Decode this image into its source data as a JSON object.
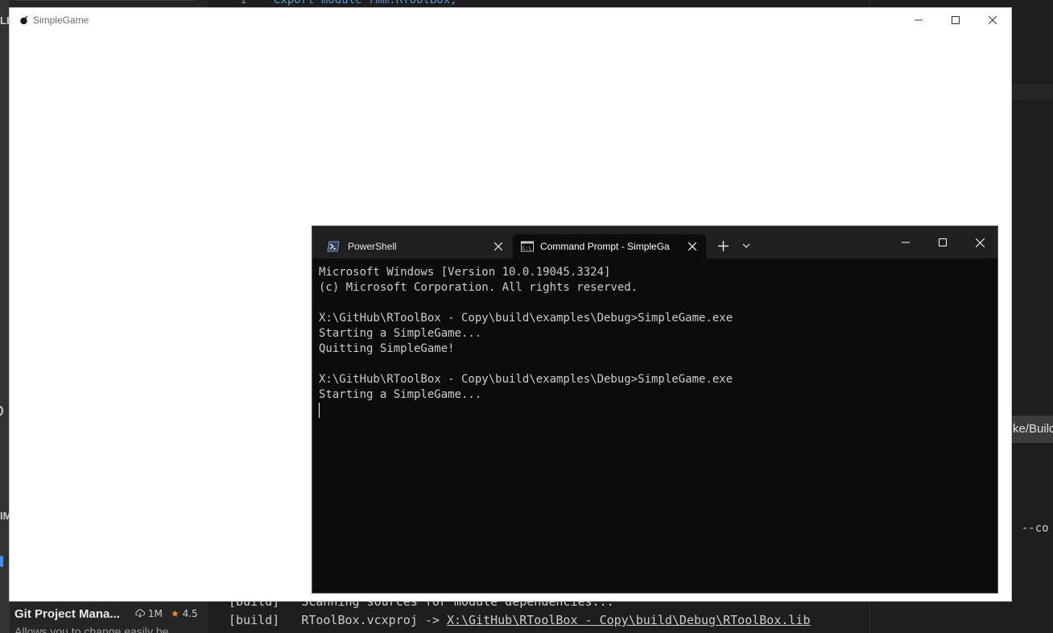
{
  "vscode": {
    "editor": {
      "line_number": "1",
      "code_line": "export module rmm.RToolBox;"
    },
    "sidebar_fragments": {
      "left_top": "LE",
      "left_mid": "IM"
    },
    "right_panel": {
      "tab_fragment": "ke/Build",
      "terminal_fragment": "' --co"
    },
    "terminal_lines": [
      {
        "prefix": "[build]",
        "text": "Scanning sources for module dependencies..."
      },
      {
        "prefix": "[build]",
        "text": "RToolBox.vcxproj -> ",
        "link": "X:\\GitHub\\RToolBox - Copy\\build\\Debug\\RToolBox.lib"
      }
    ],
    "extension": {
      "title": "Git Project Mana...",
      "downloads": "1M",
      "rating": "4.5",
      "description": "Allows you to change easily be..."
    }
  },
  "game_window": {
    "title": "SimpleGame"
  },
  "terminal_window": {
    "tabs": [
      {
        "label": "PowerShell",
        "icon": "powershell-icon",
        "active": false
      },
      {
        "label": "Command Prompt - SimpleGa",
        "icon": "cmd-icon",
        "active": true
      }
    ],
    "new_tab_symbol": "+",
    "output_lines": [
      "Microsoft Windows [Version 10.0.19045.3324]",
      "(c) Microsoft Corporation. All rights reserved.",
      "",
      "X:\\GitHub\\RToolBox - Copy\\build\\examples\\Debug>SimpleGame.exe",
      "Starting a SimpleGame...",
      "Quitting SimpleGame!",
      "",
      "X:\\GitHub\\RToolBox - Copy\\build\\examples\\Debug>SimpleGame.exe",
      "Starting a SimpleGame..."
    ]
  },
  "colors": {
    "vscode_bg": "#1e1e1e",
    "terminal_bg": "#0c0c0c",
    "terminal_tabbar": "#202020",
    "terminal_text": "#cccccc",
    "keyword_blue": "#569cd6",
    "rating_star": "#ff8e00"
  }
}
